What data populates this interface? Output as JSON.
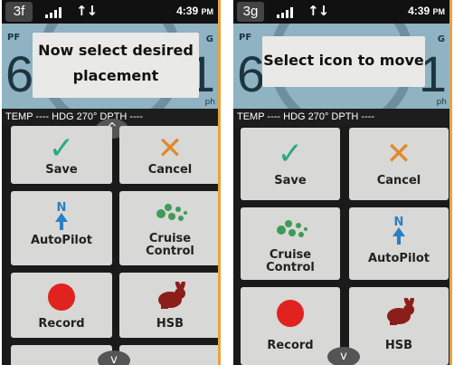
{
  "colors": {
    "accent": "#e8a33a",
    "check": "#2aa889",
    "cancel": "#e08a2c",
    "record": "#e0231e",
    "autopilot": "#2b7fc4",
    "cruise": "#3f9b55",
    "hsb": "#8b1e1a"
  },
  "left": {
    "step": "3f",
    "time": "4:39",
    "time_suffix": "PM",
    "speed_left": "6",
    "speed_right": "1",
    "tag_left": "PF",
    "tag_right": "G",
    "unit": "ph",
    "popup_line1": "Now select desired",
    "popup_line2": "placement",
    "info": "TEMP ---- HDG 270° DPTH ----",
    "tiles": {
      "save": "Save",
      "cancel": "Cancel",
      "autopilot": "AutoPilot",
      "cruise_line1": "Cruise",
      "cruise_line2": "Control",
      "record": "Record",
      "hsb": "HSB"
    }
  },
  "right": {
    "step": "3g",
    "time": "4:39",
    "time_suffix": "PM",
    "speed_left": "6",
    "speed_right": "1",
    "tag_left": "PF",
    "tag_right": "G",
    "unit": "ph",
    "popup": "Select icon to move",
    "info": "TEMP ---- HDG 270° DPTH ----",
    "tiles": {
      "save": "Save",
      "cancel": "Cancel",
      "cruise_line1": "Cruise",
      "cruise_line2": "Control",
      "autopilot": "AutoPilot",
      "record": "Record",
      "hsb": "HSB"
    }
  }
}
